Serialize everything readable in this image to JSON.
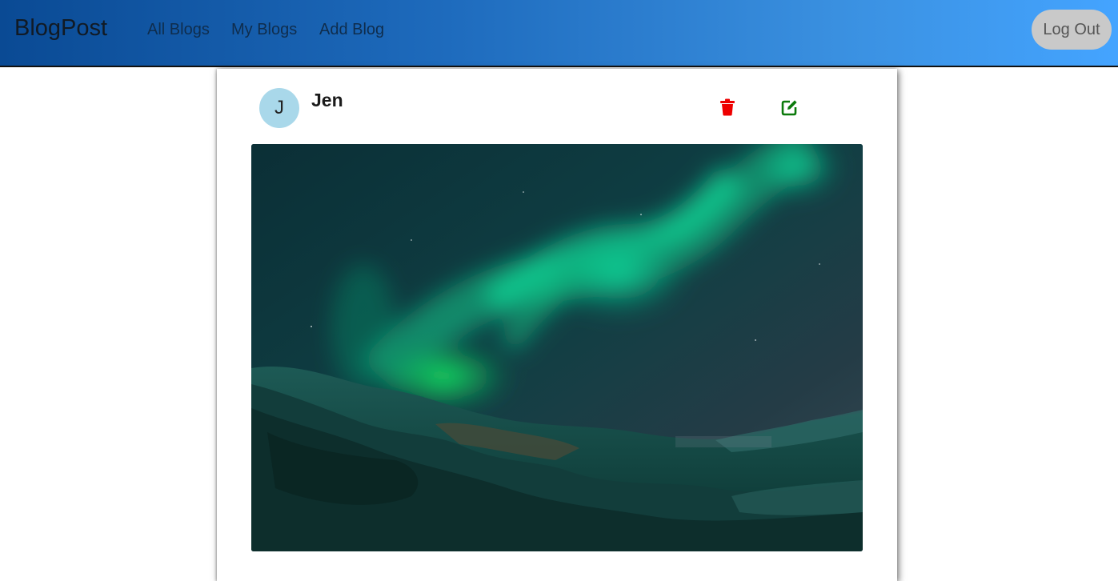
{
  "navbar": {
    "brand": "BlogPost",
    "links": [
      "All Blogs",
      "My Blogs",
      "Add Blog"
    ],
    "logout_label": "Log Out"
  },
  "post": {
    "avatar_initial": "J",
    "author": "Jen",
    "delete_icon": "trash-icon",
    "edit_icon": "edit-icon",
    "image_subject": "aurora-borealis-photo"
  },
  "colors": {
    "delete": "#ee0000",
    "edit": "#0b7a0b",
    "avatar": "#a9d8ea",
    "logout": "#c9c9c9"
  }
}
